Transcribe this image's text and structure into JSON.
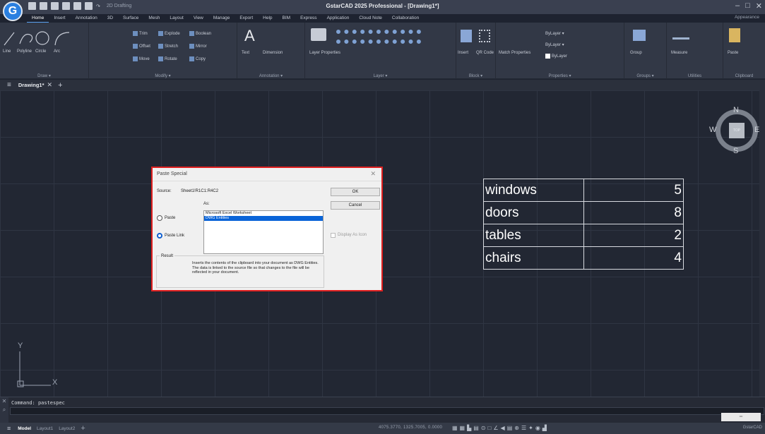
{
  "app": {
    "title": "GstarCAD 2025 Professional - [Drawing1*]",
    "workspace": "2D Drafting",
    "appearance": "Appearance",
    "logo_letter": "G",
    "window_controls": [
      "–",
      "□",
      "✕"
    ],
    "brand_color": "#2a7fe0"
  },
  "menu": {
    "tabs": [
      "Home",
      "Insert",
      "Annotation",
      "3D",
      "Surface",
      "Mesh",
      "Layout",
      "View",
      "Manage",
      "Export",
      "Help",
      "BIM",
      "Express",
      "Application",
      "Cloud Note",
      "Collaboration"
    ],
    "active": "Home"
  },
  "ribbon": {
    "panels": [
      {
        "name": "Draw",
        "label": "Draw ▾",
        "tools": [
          "Line",
          "Polyline",
          "Circle",
          "Arc"
        ]
      },
      {
        "name": "Modify",
        "label": "Modify ▾",
        "tools": [
          "Move",
          "Rotate",
          "Copy",
          "Offset",
          "Stretch",
          "Mirror",
          "Trim",
          "Explode",
          "Boolean"
        ]
      },
      {
        "name": "Annotation",
        "label": "Annotation ▾",
        "tools": [
          "Text",
          "Dimension"
        ]
      },
      {
        "name": "Layer",
        "label": "Layer ▾",
        "tools": [
          "Layer Properties"
        ]
      },
      {
        "name": "Block",
        "label": "Block ▾",
        "tools": [
          "Insert",
          "QR Code"
        ]
      },
      {
        "name": "Properties",
        "label": "Properties ▾",
        "tools": [
          "Match Properties",
          "ByLayer",
          "ByLayer",
          "ByLayer"
        ]
      },
      {
        "name": "Groups",
        "label": "Groups ▾",
        "tools": [
          "Group"
        ]
      },
      {
        "name": "Utilities",
        "label": "Utilities",
        "tools": [
          "Measure"
        ]
      },
      {
        "name": "Clipboard",
        "label": "Clipboard",
        "tools": [
          "Paste"
        ]
      }
    ]
  },
  "document": {
    "tab": "Drawing1*",
    "close": "✕",
    "add": "+"
  },
  "viewcube": {
    "n": "N",
    "s": "S",
    "e": "E",
    "w": "W",
    "face": "TOP"
  },
  "table": {
    "rows": [
      {
        "name": "windows",
        "value": "5"
      },
      {
        "name": "doors",
        "value": "8"
      },
      {
        "name": "tables",
        "value": "2"
      },
      {
        "name": "chairs",
        "value": "4"
      }
    ]
  },
  "ucs": {
    "x": "X",
    "y": "Y"
  },
  "dialog": {
    "title": "Paste Special",
    "source_label": "Source:",
    "source_value": "Sheet1!R1C1:R4C2",
    "as_label": "As:",
    "options": [
      "Microsoft Excel Worksheet",
      "DWG Entities"
    ],
    "selected_option": "DWG Entities",
    "paste": "Paste",
    "paste_link": "Paste Link",
    "paste_link_selected": true,
    "ok": "OK",
    "cancel": "Cancel",
    "display_as_icon": "Display As Icon",
    "result_label": "Result",
    "result_text": "Inserts the contents of the clipboard into your document as DWG Entities. The data is linked to the source file so that changes to the file will be reflected in your document.",
    "border_color": "#e02020"
  },
  "command": {
    "prompt": "Command:",
    "value": "pastespec"
  },
  "status": {
    "layouts": [
      "Model",
      "Layout1",
      "Layout2"
    ],
    "active_layout": "Model",
    "coords": "4075.3770, 1325.7005, 0.0000",
    "brand": "GstarCAD"
  }
}
